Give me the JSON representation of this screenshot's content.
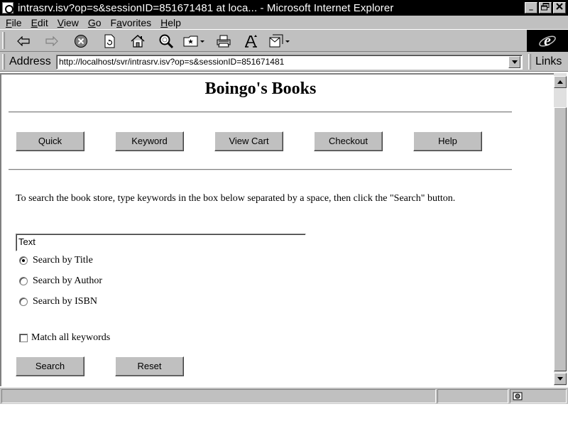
{
  "window": {
    "title": "intrasrv.isv?op=s&sessionID=851671481 at loca... - Microsoft Internet Explorer",
    "controls": {
      "minimize": "_",
      "maximize": "▫",
      "close": "×"
    }
  },
  "menu": [
    {
      "label": "File",
      "accel": "F",
      "rest": "ile"
    },
    {
      "label": "Edit",
      "accel": "E",
      "rest": "dit"
    },
    {
      "label": "View",
      "accel": "V",
      "rest": "iew"
    },
    {
      "label": "Go",
      "accel": "G",
      "rest": "o"
    },
    {
      "label": "Favorites",
      "accel": "a",
      "pre": "F",
      "rest": "vorites"
    },
    {
      "label": "Help",
      "accel": "H",
      "rest": "elp"
    }
  ],
  "toolbar": {
    "icons": [
      "back-icon",
      "forward-icon",
      "stop-icon",
      "refresh-icon",
      "home-icon",
      "search-icon",
      "favorites-icon",
      "print-icon",
      "font-icon",
      "mail-icon"
    ]
  },
  "address": {
    "label": "Address",
    "url": "http://localhost/svr/intrasrv.isv?op=s&sessionID=851671481",
    "links_label": "Links"
  },
  "page": {
    "title": "Boingo's Books",
    "nav": [
      "Quick",
      "Keyword",
      "View Cart",
      "Checkout",
      "Help"
    ],
    "instructions": "To search the book store, type keywords in the box below separated by a space, then click the \"Search\" button.",
    "search_value": "Text",
    "search_options": [
      {
        "label": "Search by Title",
        "checked": true
      },
      {
        "label": "Search by Author",
        "checked": false
      },
      {
        "label": "Search by ISBN",
        "checked": false
      }
    ],
    "match_all_label": "Match all keywords",
    "match_all_checked": false,
    "search_button": "Search",
    "reset_button": "Reset"
  }
}
